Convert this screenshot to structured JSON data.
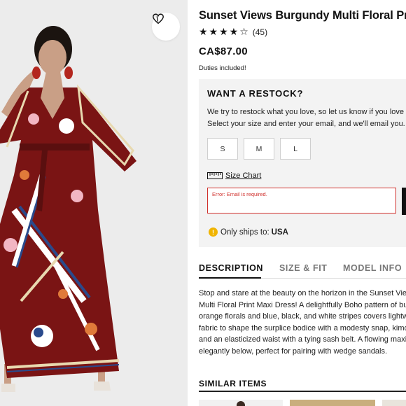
{
  "product": {
    "title": "Sunset Views Burgundy Multi Floral Print Maxi Dress",
    "rating_stars": "★★★★",
    "rating_empty_star": "☆",
    "review_count": "(45)",
    "price": "CA$87.00",
    "duties": "Duties included!"
  },
  "image": {
    "wishlist_icon": "heart-icon",
    "dress_color": "#7a1414"
  },
  "restock": {
    "title": "WANT A RESTOCK?",
    "line1": "We try to restock what you love, so let us know if you love it!",
    "line2": "Select your size and enter your email, and we'll email you.",
    "sizes": [
      "S",
      "M",
      "L"
    ],
    "size_chart_label": "Size Chart",
    "email_error": "Error: Email is required.",
    "ships_label": "Only ships to:",
    "ships_country": "USA"
  },
  "tabs": [
    "DESCRIPTION",
    "SIZE & FIT",
    "MODEL INFO"
  ],
  "description": [
    "Stop and stare at the beauty on the horizon in the Sunset Views Burgundy",
    "Multi Floral Print Maxi Dress! A delightfully Boho pattern of burgundy, pink,",
    "orange florals and blue, black, and white stripes covers lightweight woven",
    "fabric to shape the surplice bodice with a modesty snap, kimono sleeves,",
    "and an elasticized waist with a tying sash belt. A flowing maxi skirt falls",
    "elegantly below, perfect for pairing with wedge sandals."
  ],
  "similar_items": {
    "title": "SIMILAR ITEMS"
  },
  "colors": {
    "accent": "#111111",
    "error": "#d0312d",
    "panel": "#f3f3f3",
    "warning": "#f0b400"
  }
}
